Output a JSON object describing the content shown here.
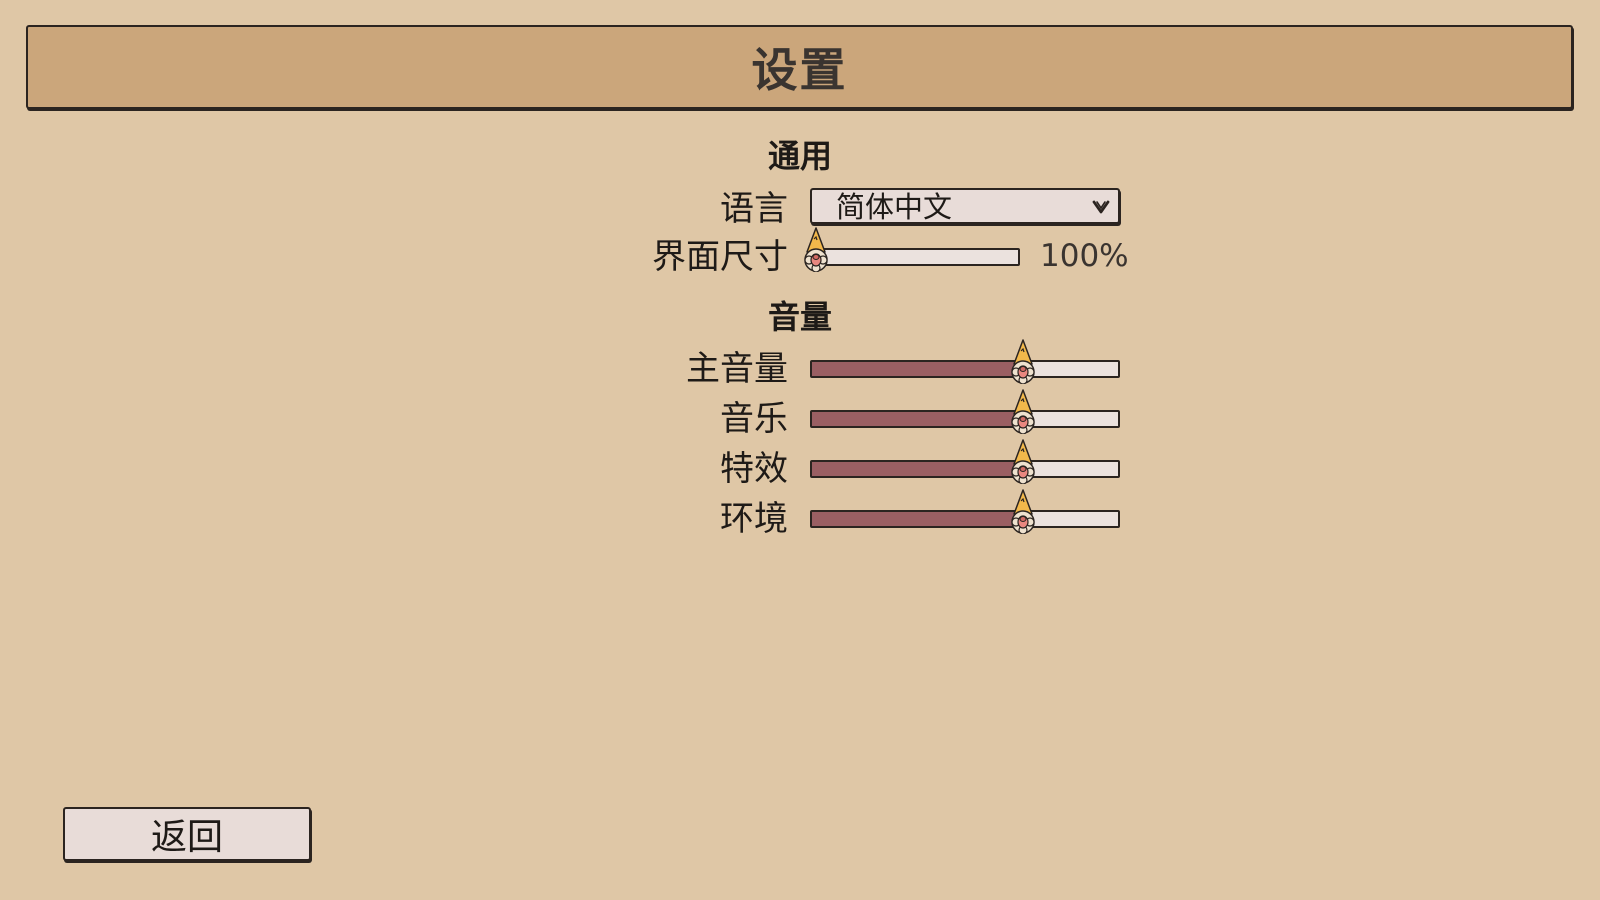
{
  "header": {
    "title": "设置"
  },
  "general": {
    "heading": "通用",
    "language": {
      "label": "语言",
      "selected": "简体中文",
      "icon": "chevron-down-icon"
    },
    "ui_scale": {
      "label": "界面尺寸",
      "value_text": "100%",
      "level": 0.0
    }
  },
  "volume": {
    "heading": "音量",
    "sliders": [
      {
        "label": "主音量",
        "level": 0.69
      },
      {
        "label": "音乐",
        "level": 0.69
      },
      {
        "label": "特效",
        "level": 0.69
      },
      {
        "label": "环境",
        "level": 0.69
      }
    ]
  },
  "footer": {
    "back_label": "返回"
  },
  "colors": {
    "background": "#dfc7a6",
    "title_bar": "#cba67b",
    "slider_fill": "#9a5f63",
    "slider_track": "#ebe2de",
    "handle_hat": "#f2b84b"
  }
}
